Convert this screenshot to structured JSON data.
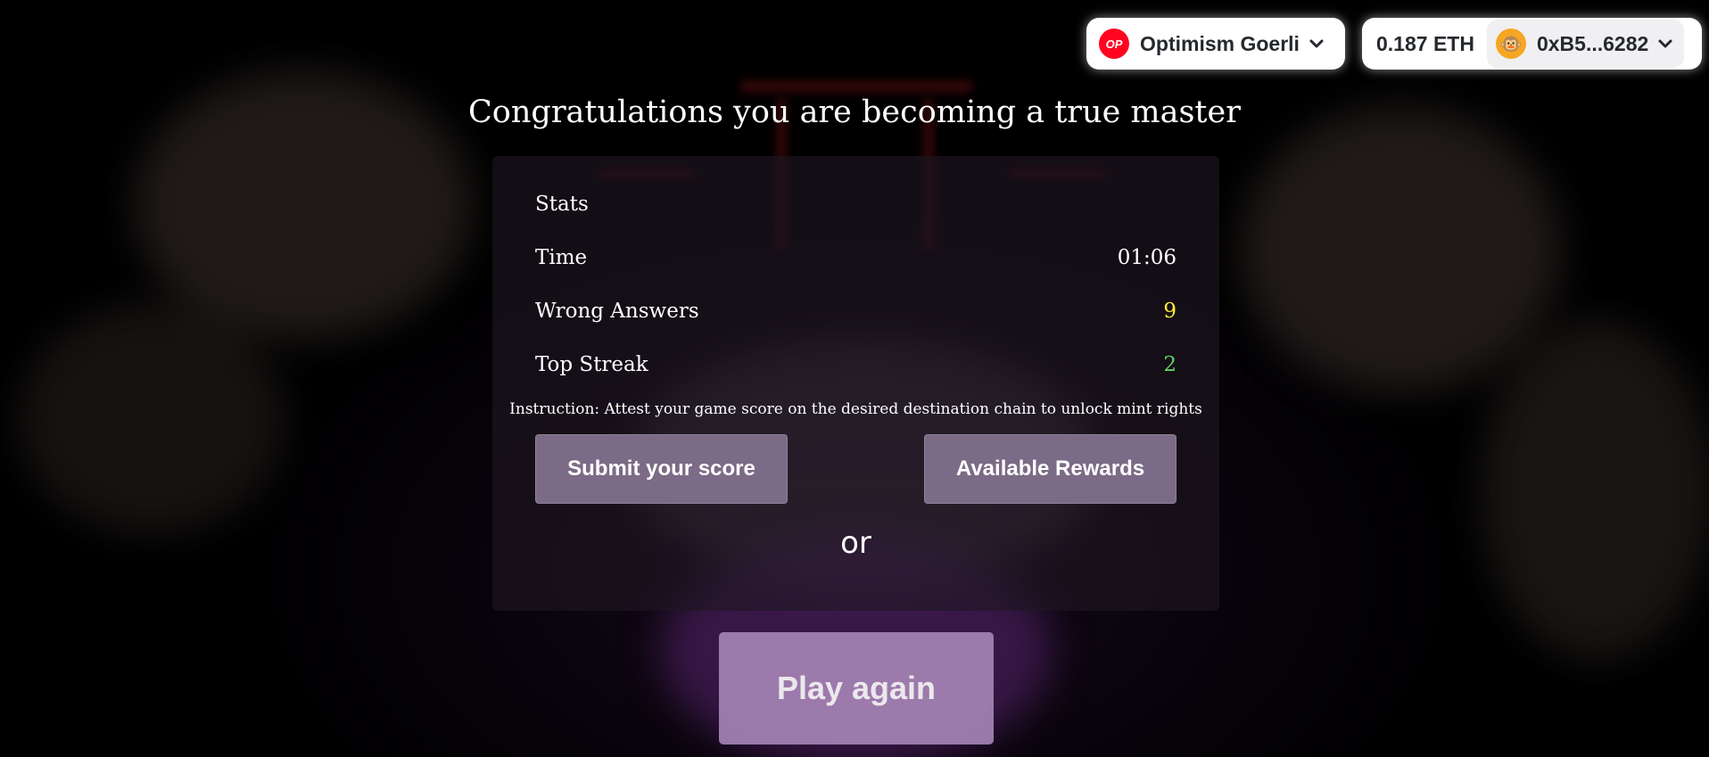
{
  "wallet": {
    "network_badge": "OP",
    "network_name": "Optimism Goerli",
    "balance": "0.187 ETH",
    "avatar_emoji": "🐵",
    "address": "0xB5...6282",
    "accent_color": "#ff0420"
  },
  "headline": "Congratulations you are becoming a true master",
  "stats": {
    "title": "Stats",
    "rows": [
      {
        "label": "Time",
        "value": "01:06"
      },
      {
        "label": "Wrong Answers",
        "value": "9"
      },
      {
        "label": "Top Streak",
        "value": "2"
      }
    ]
  },
  "instruction": "Instruction: Attest your game score on the desired destination chain to unlock mint rights",
  "buttons": {
    "submit": "Submit your score",
    "rewards": "Available Rewards",
    "or": "or",
    "play_again": "Play again"
  }
}
